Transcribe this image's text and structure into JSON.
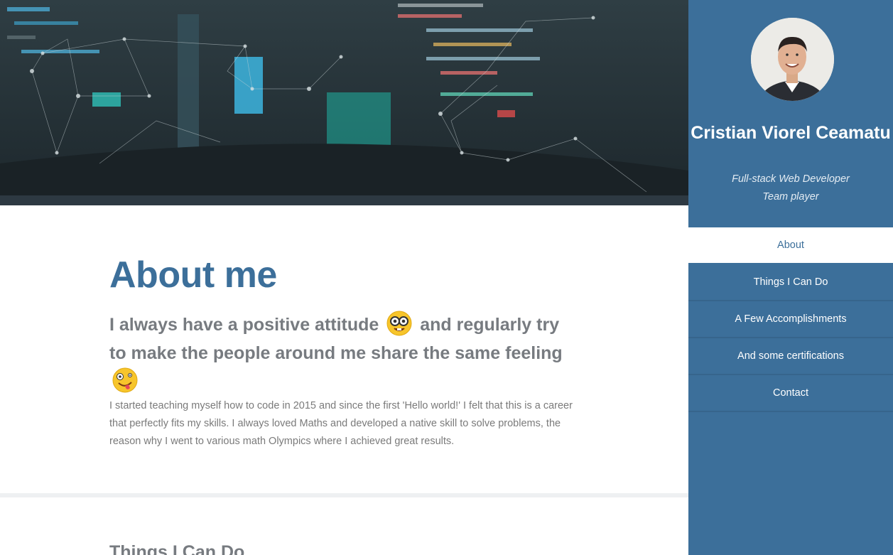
{
  "profile": {
    "name": "Cristian Viorel Ceamatu",
    "subtitle_line1": "Full-stack Web Developer",
    "subtitle_line2": "Team player"
  },
  "nav": {
    "items": [
      {
        "label": "About",
        "active": true
      },
      {
        "label": "Things I Can Do",
        "active": false
      },
      {
        "label": "A Few Accomplishments",
        "active": false
      },
      {
        "label": "And some certifications",
        "active": false
      },
      {
        "label": "Contact",
        "active": false
      }
    ]
  },
  "about": {
    "title": "About me",
    "tagline_part1": "I always have a positive attitude",
    "tagline_part2": "and regularly try to make the people around me share the same feeling",
    "bio": "I started teaching myself how to code in 2015 and since the first 'Hello world!' I felt that this is a career that perfectly fits my skills. I always loved Maths and developed a native skill to solve problems, the reason why I went to various math Olympics where I achieved great results."
  },
  "next_section": {
    "title": "Things I Can Do"
  },
  "icons": {
    "emoji1": "nerd-face-icon",
    "emoji2": "zany-face-icon"
  },
  "colors": {
    "accent": "#3c6f9a",
    "sidebar_bg": "#3c6f9a",
    "heading_gray": "#777b80",
    "text_gray": "#7a7a7a"
  }
}
